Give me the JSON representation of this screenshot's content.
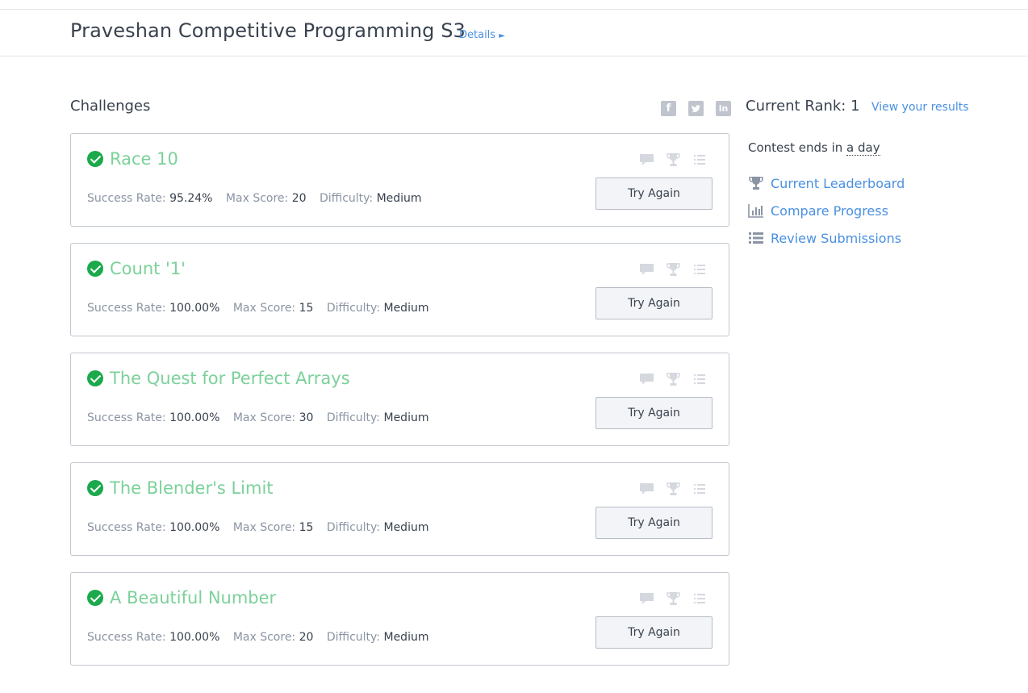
{
  "header": {
    "contest_title": "Praveshan Competitive Programming S3",
    "details_label": "Details",
    "details_arrow": "►"
  },
  "challenges": {
    "section_title": "Challenges",
    "items": [
      {
        "title": "Race 10",
        "success_rate_label": "Success Rate:",
        "success_rate": "95.24%",
        "max_score_label": "Max Score:",
        "max_score": "20",
        "difficulty_label": "Difficulty:",
        "difficulty": "Medium",
        "button": "Try Again"
      },
      {
        "title": "Count '1'",
        "success_rate_label": "Success Rate:",
        "success_rate": "100.00%",
        "max_score_label": "Max Score:",
        "max_score": "15",
        "difficulty_label": "Difficulty:",
        "difficulty": "Medium",
        "button": "Try Again"
      },
      {
        "title": "The Quest for Perfect Arrays",
        "success_rate_label": "Success Rate:",
        "success_rate": "100.00%",
        "max_score_label": "Max Score:",
        "max_score": "30",
        "difficulty_label": "Difficulty:",
        "difficulty": "Medium",
        "button": "Try Again"
      },
      {
        "title": "The Blender's Limit",
        "success_rate_label": "Success Rate:",
        "success_rate": "100.00%",
        "max_score_label": "Max Score:",
        "max_score": "15",
        "difficulty_label": "Difficulty:",
        "difficulty": "Medium",
        "button": "Try Again"
      },
      {
        "title": "A Beautiful Number",
        "success_rate_label": "Success Rate:",
        "success_rate": "100.00%",
        "max_score_label": "Max Score:",
        "max_score": "20",
        "difficulty_label": "Difficulty:",
        "difficulty": "Medium",
        "button": "Try Again"
      }
    ],
    "card_icons": [
      "discussion-icon",
      "leaderboard-icon",
      "submissions-icon"
    ]
  },
  "social": {
    "facebook": "f",
    "twitter": "t",
    "linkedin": "in"
  },
  "sidebar": {
    "rank_text": "Current Rank: 1",
    "view_results": "View your results",
    "ends_prefix": "Contest ends in ",
    "ends_time": "a day",
    "links": [
      {
        "label": "Current Leaderboard",
        "icon": "trophy-icon"
      },
      {
        "label": "Compare Progress",
        "icon": "bar-chart-icon"
      },
      {
        "label": "Review Submissions",
        "icon": "list-icon"
      }
    ]
  },
  "colors": {
    "accent": "#4a90e2",
    "solved_title": "#7bd19a",
    "check": "#1ba94c",
    "muted_icon": "#d5d8de"
  }
}
